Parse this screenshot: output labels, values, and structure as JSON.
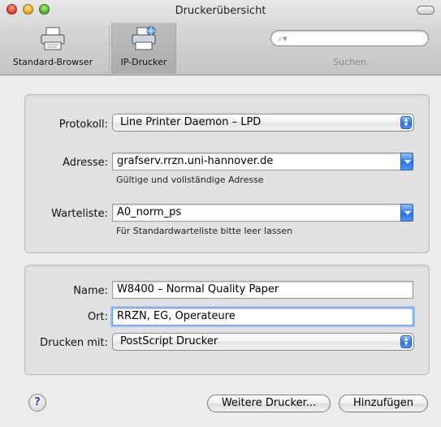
{
  "window": {
    "title": "Druckerübersicht"
  },
  "toolbar": {
    "items": [
      {
        "label": "Standard-Browser",
        "icon": "printer-icon"
      },
      {
        "label": "IP-Drucker",
        "icon": "network-printer-icon",
        "selected": true
      }
    ],
    "search": {
      "label": "Suchen",
      "value": ""
    }
  },
  "connection": {
    "protocol_label": "Protokoll:",
    "protocol_value": "Line Printer Daemon – LPD",
    "address_label": "Adresse:",
    "address_value": "grafserv.rrzn.uni-hannover.de",
    "address_hint": "Gültige und vollständige Adresse",
    "queue_label": "Warteliste:",
    "queue_value": "A0_norm_ps",
    "queue_hint": "Für Standardwarteliste bitte leer lassen"
  },
  "details": {
    "name_label": "Name:",
    "name_value": "W8400 – Normal Quality Paper",
    "location_label": "Ort:",
    "location_value": "RRZN, EG, Operateure",
    "print_with_label": "Drucken mit:",
    "print_with_value": "PostScript Drucker"
  },
  "footer": {
    "help_symbol": "?",
    "more_printers": "Weitere Drucker...",
    "add": "Hinzufügen"
  }
}
